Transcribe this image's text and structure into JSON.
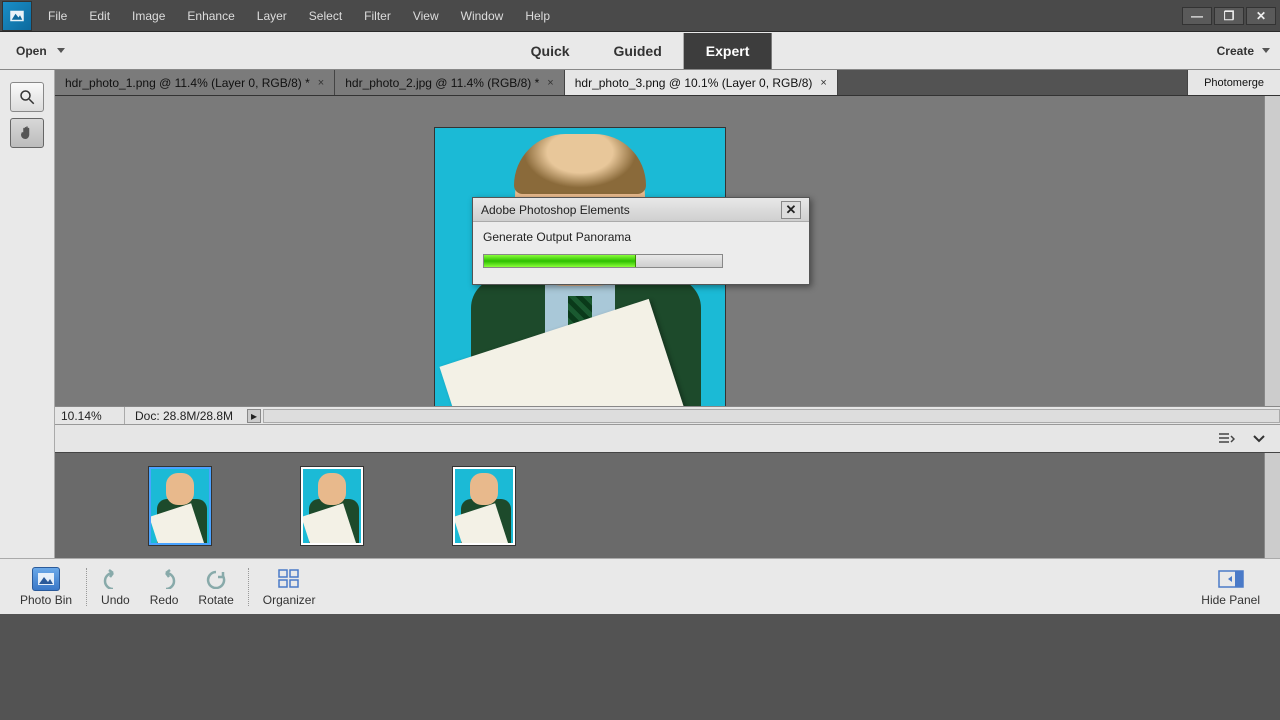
{
  "menubar": {
    "items": [
      "File",
      "Edit",
      "Image",
      "Enhance",
      "Layer",
      "Select",
      "Filter",
      "View",
      "Window",
      "Help"
    ]
  },
  "win_controls": {
    "min": "—",
    "max": "❐",
    "close": "✕"
  },
  "modebar": {
    "open_label": "Open",
    "modes": [
      "Quick",
      "Guided",
      "Expert"
    ],
    "active_mode": "Expert",
    "create_label": "Create"
  },
  "tools": {
    "zoom": "zoom-icon",
    "hand": "hand-icon"
  },
  "doctabs": {
    "tabs": [
      {
        "label": "hdr_photo_1.png @ 11.4% (Layer 0, RGB/8) *",
        "active": false
      },
      {
        "label": "hdr_photo_2.jpg @ 11.4% (RGB/8) *",
        "active": false
      },
      {
        "label": "hdr_photo_3.png @ 10.1% (Layer 0, RGB/8)",
        "active": true
      }
    ],
    "right_tab": "Photomerge"
  },
  "status": {
    "zoom": "10.14%",
    "docinfo": "Doc: 28.8M/28.8M"
  },
  "dialog": {
    "title": "Adobe Photoshop Elements",
    "message": "Generate Output Panorama",
    "progress_pct": 64
  },
  "bottombar": {
    "photobin": "Photo Bin",
    "undo": "Undo",
    "redo": "Redo",
    "rotate": "Rotate",
    "organizer": "Organizer",
    "hide_panel": "Hide Panel"
  }
}
